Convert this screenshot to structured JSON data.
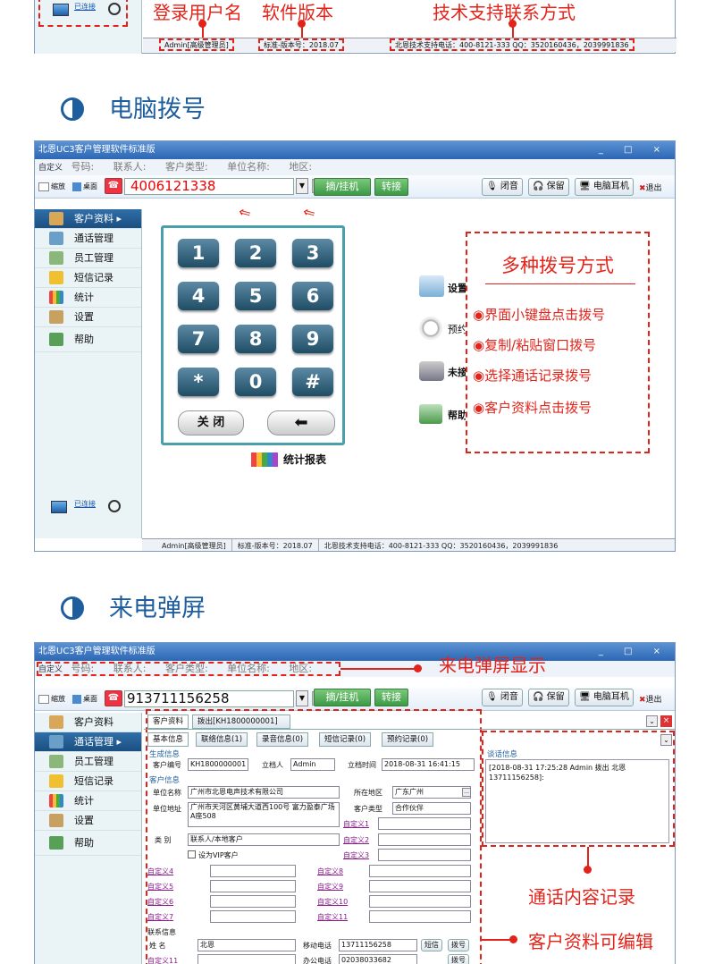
{
  "top": {
    "sidebar_status": "已连接",
    "annot_user": "登录用户名",
    "annot_version": "软件版本",
    "annot_support": "技术支持联系方式",
    "status_user": "Admin[高级管理员]",
    "status_version": "标准-版本号：2018.07",
    "status_support": "北恩技术支持电话：400-8121-333  QQ：3520160436，2039991836"
  },
  "section1": {
    "heading": "电脑拨号"
  },
  "section2": {
    "heading": "来电弹屏"
  },
  "window": {
    "title": "北恩UC3客户管理软件标准版",
    "controls": "_ □ ×",
    "filter": {
      "custom": "自定义",
      "number": "号码:",
      "contact": "联系人:",
      "type": "客户类型:",
      "company": "单位名称:",
      "area": "地区:"
    },
    "shrink": "缩放",
    "desktop": "桌面",
    "dial_btn": "摘/挂机",
    "transfer_btn": "转接",
    "mute": "闭音",
    "hold": "保留",
    "headset": "电脑耳机",
    "exit": "退出"
  },
  "dial": {
    "number": "4006121338",
    "sidebar": [
      "客户资料",
      "通话管理",
      "员工管理",
      "短信记录",
      "统计",
      "设置",
      "帮助"
    ],
    "keypad": [
      "1",
      "2",
      "3",
      "4",
      "5",
      "6",
      "7",
      "8",
      "9",
      "*",
      "0",
      "#"
    ],
    "close": "关 闭",
    "back": "⬅",
    "right_items": [
      "设置",
      "预约客户",
      "未接",
      "帮助"
    ],
    "stats": "统计报表",
    "connected": "已连接",
    "annot_title": "多种拨号方式",
    "annot_items": [
      "界面小键盘点击拨号",
      "复制/粘贴窗口拨号",
      "选择通话记录拨号",
      "客户资料点击拨号"
    ],
    "status_user": "Admin[高级管理员]",
    "status_version": "标准-版本号：2018.07",
    "status_support": "北恩技术支持电话：400-8121-333  QQ：3520160436，2039991836"
  },
  "popup": {
    "number": "913711156258",
    "annot_popup": "来电弹屏显示",
    "annot_record": "通话内容记录",
    "annot_edit": "客户资料可编辑",
    "sidebar": [
      "客户资料",
      "通话管理",
      "员工管理",
      "短信记录",
      "统计",
      "设置",
      "帮助"
    ],
    "tab_main": "客户资料",
    "tab_call": "拨出[KH1800000001]",
    "subtabs": [
      "基本信息",
      "联络信息(1)",
      "录音信息(0)",
      "短信记录(0)",
      "预约记录(0)"
    ],
    "gen_info": "生成信息",
    "cust_info": "客户信息",
    "contact_info": "联系信息",
    "labels": {
      "no": "客户编号",
      "creator": "立档人",
      "time": "立档时间",
      "name": "单位名称",
      "region": "所在地区",
      "addr": "单位地址",
      "ctype": "客户类型",
      "cat": "类 别",
      "vip": "设为VIP客户",
      "person": "姓 名",
      "mobile": "移动电话",
      "office": "办公电话"
    },
    "values": {
      "no": "KH1800000001",
      "creator": "Admin",
      "time": "2018-08-31 16:41:15",
      "name": "广州市北恩电声技术有限公司",
      "region": "广东广州",
      "addr": "广州市天河区黄埔大道西100号 富力盈泰广场A座508",
      "ctype": "合作伙伴",
      "cat": "联系人/本地客户",
      "person": "北恩",
      "mobile": "13711156258",
      "office": "02038033682"
    },
    "custom": [
      "自定义1",
      "自定义2",
      "自定义3",
      "自定义4",
      "自定义5",
      "自定义6",
      "自定义7",
      "自定义8",
      "自定义9",
      "自定义10",
      "自定义11",
      "自定义11"
    ],
    "sms": "短信",
    "dialk": "拨号",
    "talk_label": "谈话信息",
    "talk_text": "[2018-08-31 17:25:28 Admin 拨出 北恩 13711156258]:"
  }
}
